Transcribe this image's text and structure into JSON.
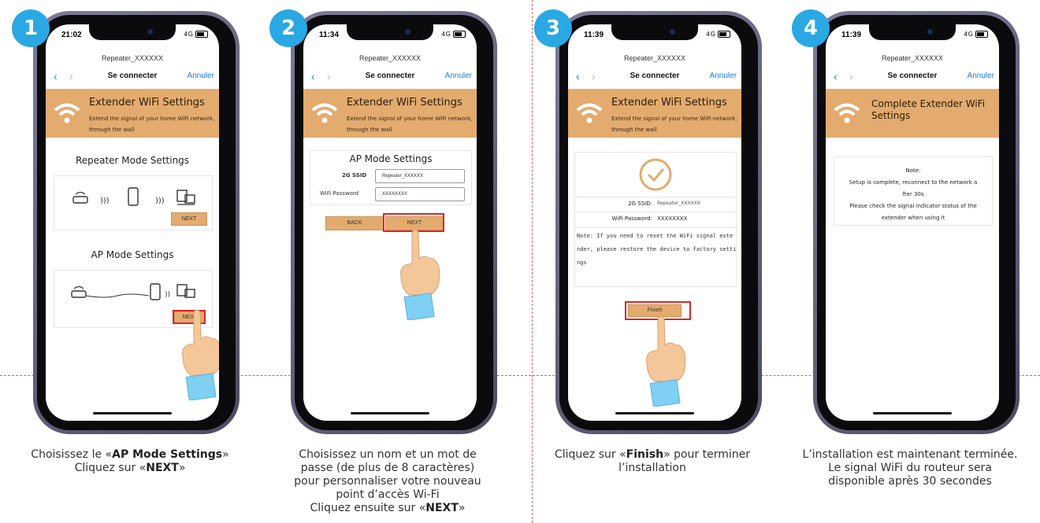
{
  "colors": {
    "badge": "#2aa8e4",
    "banner": "#e3ab6e",
    "button": "#e3ab6e",
    "highlight": "#d9262a",
    "divider": "#e45a5a",
    "ios_link": "#1a7bd4"
  },
  "common": {
    "page_title": "Repeater_XXXXXX",
    "nav_title": "Se connecter",
    "cancel": "Annuler",
    "banner_title": "Extender WiFi Settings",
    "banner_sub": "Extend the signal of your home WiFi network, through the wall"
  },
  "steps": [
    {
      "number": "1",
      "time": "21:02",
      "signal": "4G",
      "repeater_title": "Repeater Mode Settings",
      "ap_title": "AP Mode Settings",
      "next": "NEXT",
      "caption": {
        "pre1": "Choisissez le «",
        "b1": "AP Mode Settings",
        "post1": "»",
        "pre2": "Cliquez sur «",
        "b2": "NEXT",
        "post2": "»"
      }
    },
    {
      "number": "2",
      "time": "11:34",
      "signal": "4G",
      "form_title": "AP Mode Settings",
      "ssid_label": "2G SSID",
      "ssid_value": "Repeater_XXXXXX",
      "pwd_label": "WiFi Password",
      "pwd_value": "XXXXXXXX",
      "back": "BACK",
      "next": "NEXT",
      "caption": {
        "l1": "Choisissez un nom et un mot de",
        "l2": "passe (de plus de 8 caractères)",
        "l3": "pour personnaliser votre nouveau",
        "l4": "point d’accès Wi-Fi",
        "pre5": "Cliquez ensuite sur «",
        "b5": "NEXT",
        "post5": "»"
      }
    },
    {
      "number": "3",
      "time": "11:39",
      "signal": "4G",
      "ssid_label": "2G SSID:",
      "ssid_value": "Repeater_XXXXXX",
      "pwd_label": "WiFi Password:",
      "pwd_value": "XXXXXXXX",
      "note_l1": "Note: If you need to reset the WiFi signal exte",
      "note_l2": "nder, please restore the device to factory setti",
      "note_l3": "ngs",
      "finish": "Finish",
      "caption": {
        "pre1": "Cliquez sur «",
        "b1": "Finish",
        "post1": "» pour terminer",
        "l2": "l’installation"
      }
    },
    {
      "number": "4",
      "time": "11:39",
      "signal": "4G",
      "banner_title_l1": "Complete Extender WiFi",
      "banner_title_l2": "Settings",
      "note_title": "Note:",
      "note_l1": "Setup is complete, reconnect to the network a",
      "note_l2": "fter 30s",
      "note_l3a": "Please check the signal indicator",
      "note_l3b": " status of the",
      "note_l4": "extender when using it",
      "caption": {
        "l1": "L’installation est maintenant terminée.",
        "l2": "Le signal WiFi du routeur sera",
        "l3": "disponible après 30 secondes"
      }
    }
  ]
}
